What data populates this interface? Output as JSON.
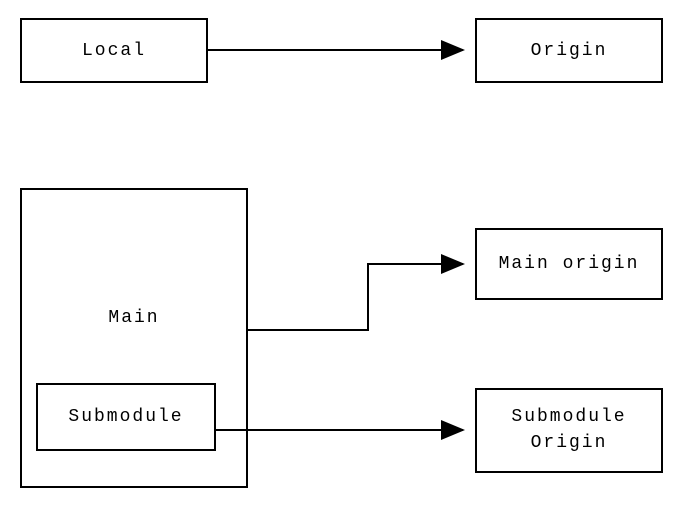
{
  "boxes": {
    "local": "Local",
    "origin": "Origin",
    "main": "Main",
    "submodule": "Submodule",
    "main_origin": "Main origin",
    "submodule_origin": "Submodule\nOrigin"
  },
  "relations": [
    {
      "from": "local",
      "to": "origin",
      "type": "arrow"
    },
    {
      "from": "main",
      "to": "main_origin",
      "type": "elbow-arrow"
    },
    {
      "from": "submodule",
      "to": "submodule_origin",
      "type": "arrow"
    }
  ]
}
